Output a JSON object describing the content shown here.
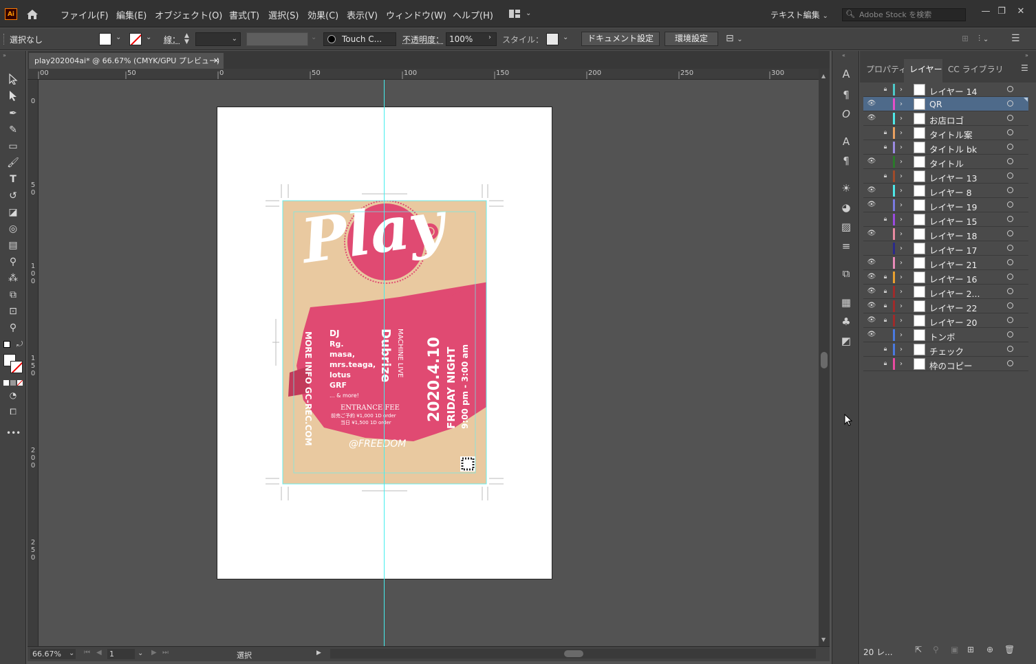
{
  "menubar": {
    "logo": "Ai",
    "items": [
      "ファイル(F)",
      "編集(E)",
      "オブジェクト(O)",
      "書式(T)",
      "選択(S)",
      "効果(C)",
      "表示(V)",
      "ウィンドウ(W)",
      "ヘルプ(H)"
    ],
    "workspace": "テキスト編集",
    "search_placeholder": "Adobe Stock を検索"
  },
  "control": {
    "selection": "選択なし",
    "stroke_label": "線：",
    "brush": "Touch C...",
    "opacity_label": "不透明度：",
    "opacity": "100%",
    "style_label": "スタイル：",
    "doc_setup": "ドキュメント設定",
    "prefs": "環境設定"
  },
  "document": {
    "tab_title": "play202004ai* @ 66.67% (CMYK/GPU プレビュー)",
    "zoom": "66.67%",
    "artboard": "1",
    "status": "選択"
  },
  "ruler": {
    "h": [
      "00",
      "50",
      "0",
      "50",
      "100",
      "150",
      "200",
      "250",
      "300"
    ],
    "v": [
      "0",
      "50",
      "100",
      "150",
      "200",
      "250"
    ]
  },
  "poster": {
    "title": "Play",
    "dj_label": "DJ",
    "djs": [
      "Rg.",
      "masa,",
      "mrs.teaga,",
      "lotus",
      "GRF",
      "... & more!"
    ],
    "guest": "Dubrize",
    "guest_sub": "MACHINE LIVE",
    "date": "2020.4.10",
    "day": "FRIDAY NIGHT",
    "time": "9:00 pm - 3:00 am",
    "side_text": "MORE INFO",
    "side_text2": "GC-REC.COM",
    "fee_title": "ENTRANCE FEE",
    "fee1": "前売ご予約 ¥1,000 1D order",
    "fee2": "当日 ¥1,500 1D order",
    "venue": "@FREEDOM"
  },
  "panels": {
    "tabs": [
      "プロパティ",
      "レイヤー",
      "CC ライブラリ"
    ],
    "layer_count": "20 レ...",
    "layers": [
      {
        "name": "レイヤー 14",
        "visible": false,
        "locked": true,
        "color": "#4dc9c9"
      },
      {
        "name": "QR",
        "visible": true,
        "locked": false,
        "color": "#e44ec8",
        "selected": true
      },
      {
        "name": "お店ロゴ",
        "visible": true,
        "locked": false,
        "color": "#4ee8e8"
      },
      {
        "name": "タイトル案",
        "visible": false,
        "locked": true,
        "color": "#e8a060"
      },
      {
        "name": "タイトル bk",
        "visible": false,
        "locked": true,
        "color": "#9a8ae0"
      },
      {
        "name": "タイトル",
        "visible": true,
        "locked": false,
        "color": "#2a7a2a"
      },
      {
        "name": "レイヤー 13",
        "visible": false,
        "locked": true,
        "color": "#a04b2a"
      },
      {
        "name": "レイヤー 8",
        "visible": true,
        "locked": false,
        "color": "#4ee8e8"
      },
      {
        "name": "レイヤー 19",
        "visible": true,
        "locked": false,
        "color": "#7a7ae0"
      },
      {
        "name": "レイヤー 15",
        "visible": false,
        "locked": true,
        "color": "#9a4ae0"
      },
      {
        "name": "レイヤー 18",
        "visible": true,
        "locked": false,
        "color": "#e88aa0"
      },
      {
        "name": "レイヤー 17",
        "visible": false,
        "locked": false,
        "color": "#2a2a8a"
      },
      {
        "name": "レイヤー 21",
        "visible": true,
        "locked": false,
        "color": "#e88ab8"
      },
      {
        "name": "レイヤー 16",
        "visible": true,
        "locked": true,
        "color": "#e8a030"
      },
      {
        "name": "レイヤー 2...",
        "visible": true,
        "locked": true,
        "color": "#a02a2a"
      },
      {
        "name": "レイヤー 22",
        "visible": true,
        "locked": true,
        "color": "#a02a2a"
      },
      {
        "name": "レイヤー 20",
        "visible": true,
        "locked": true,
        "color": "#a02a2a"
      },
      {
        "name": "トンボ",
        "visible": true,
        "locked": false,
        "color": "#4a7ae0"
      },
      {
        "name": "チェック",
        "visible": false,
        "locked": true,
        "color": "#4a7ae0"
      },
      {
        "name": "枠のコピー",
        "visible": false,
        "locked": true,
        "color": "#e84aa0"
      }
    ]
  }
}
